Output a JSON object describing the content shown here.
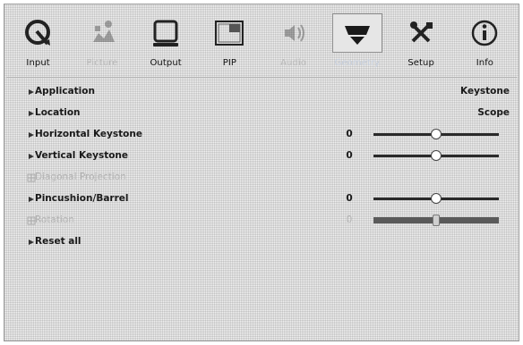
{
  "tabs": [
    {
      "label": "Input",
      "icon": "input-icon",
      "state": "normal"
    },
    {
      "label": "Picture",
      "icon": "picture-icon",
      "state": "disabled"
    },
    {
      "label": "Output",
      "icon": "output-icon",
      "state": "normal"
    },
    {
      "label": "PIP",
      "icon": "pip-icon",
      "state": "normal"
    },
    {
      "label": "Audio",
      "icon": "audio-icon",
      "state": "disabled"
    },
    {
      "label": "Geometry",
      "icon": "geometry-icon",
      "state": "active"
    },
    {
      "label": "Setup",
      "icon": "setup-icon",
      "state": "normal"
    },
    {
      "label": "Info",
      "icon": "info-icon",
      "state": "normal"
    }
  ],
  "rows": {
    "application": {
      "label": "Application",
      "value": "Keystone"
    },
    "location": {
      "label": "Location",
      "value": "Scope"
    },
    "horizontal_keystone": {
      "label": "Horizontal Keystone",
      "value": "0",
      "level": 0.5
    },
    "vertical_keystone": {
      "label": "Vertical Keystone",
      "value": "0",
      "level": 0.5
    },
    "diagonal_projection": {
      "label": "Diagonal Projection"
    },
    "pincushion_barrel": {
      "label": "Pincushion/Barrel",
      "value": "0",
      "level": 0.5
    },
    "rotation": {
      "label": "Rotation",
      "value": "0",
      "level": 0.5
    },
    "reset_all": {
      "label": "Reset all"
    }
  },
  "colors": {
    "accent_active_label": "#c7d0df",
    "disabled_text": "#b4b4b4"
  }
}
